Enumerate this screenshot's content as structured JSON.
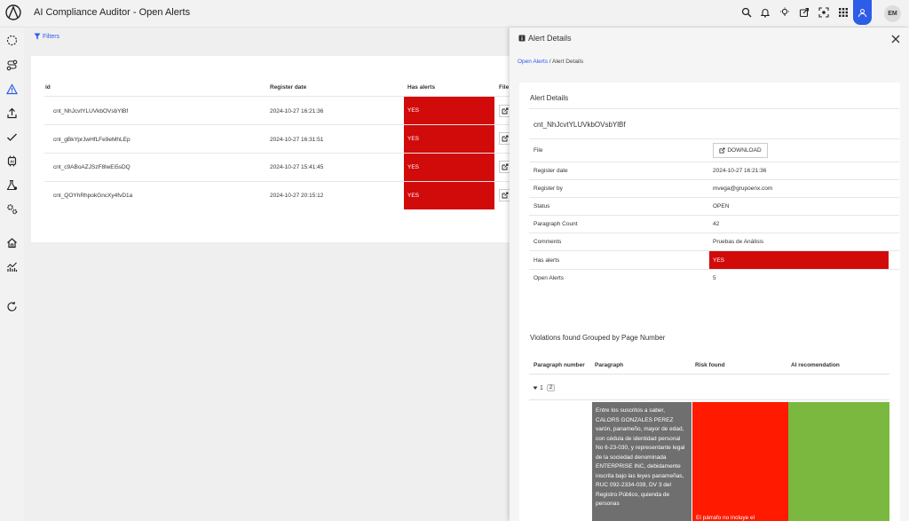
{
  "app": {
    "title": "AI Compliance Auditor - Open Alerts"
  },
  "user": {
    "initials": "EM"
  },
  "filters": {
    "label": "Filters"
  },
  "table": {
    "headers": {
      "id": "id",
      "register_date": "Register date",
      "has_alerts": "Has alerts",
      "file": "File"
    },
    "rows": [
      {
        "id": "cnt_NhJcvtYLUVkbOVsbYlBf",
        "date": "2024-10-27 16:21:36",
        "alerts": "YES"
      },
      {
        "id": "cnt_gBkYprJwHfLFe9eMhLEp",
        "date": "2024-10-27 16:31:51",
        "alerts": "YES"
      },
      {
        "id": "cnt_c9ABoAZJSzF8lwEi5sDQ",
        "date": "2024-10-27 15:41:45",
        "alerts": "YES"
      },
      {
        "id": "cnt_QOYhRhpokGncXy4fvD1a",
        "date": "2024-10-27 20:15:12",
        "alerts": "YES"
      }
    ]
  },
  "panel": {
    "title": "Alert Details",
    "breadcrumb": {
      "link": "Open Alerts",
      "separator": " / ",
      "current": "Alert Details"
    },
    "details": {
      "card_title": "Alert Details",
      "id": "cnt_NhJcvtYLUVkbOVsbYlBf",
      "download_label": "DOWNLOAD",
      "fields": {
        "file": "File",
        "register_date": "Register date",
        "register_date_value": "2024-10-27 16:21:36",
        "register_by": "Register by",
        "register_by_value": "mvega@grupoenx.com",
        "status": "Status",
        "status_value": "OPEN",
        "paragraph_count": "Paragraph Count",
        "paragraph_count_value": "42",
        "comments": "Comments",
        "comments_value": "Pruebas de Análisis",
        "has_alerts": "Has alerts",
        "has_alerts_value": "YES",
        "open_alerts": "Open Alerts",
        "open_alerts_value": "5"
      }
    },
    "violations": {
      "title": "Violations found Grouped by Page Number",
      "headers": {
        "paragraph_number": "Paragraph number",
        "paragraph": "Paragraph",
        "risk": "Risk found",
        "recommendation": "AI recomendation"
      },
      "group": {
        "label": "1",
        "count": "2"
      },
      "paragraph_text": "Entre los suscritos a saber, CALORS GONZALES PEREZ varón, panameño, mayor de edad, con cédula de identidad personal No 6-23-030, y representante legal de la sociedad denominada ENTERPRISE INC, debidamente inscrita bajo las leyes panameñas, RUC 092-2334-039, DV 3 del Registro Público, quienda de personas",
      "risk_text": "El párrafo no incluye el"
    }
  },
  "colors": {
    "accent": "#2d5ce8",
    "alert_red": "#d10a0a",
    "risk_red": "#ff1a00",
    "rec_green": "#7ab83f"
  }
}
